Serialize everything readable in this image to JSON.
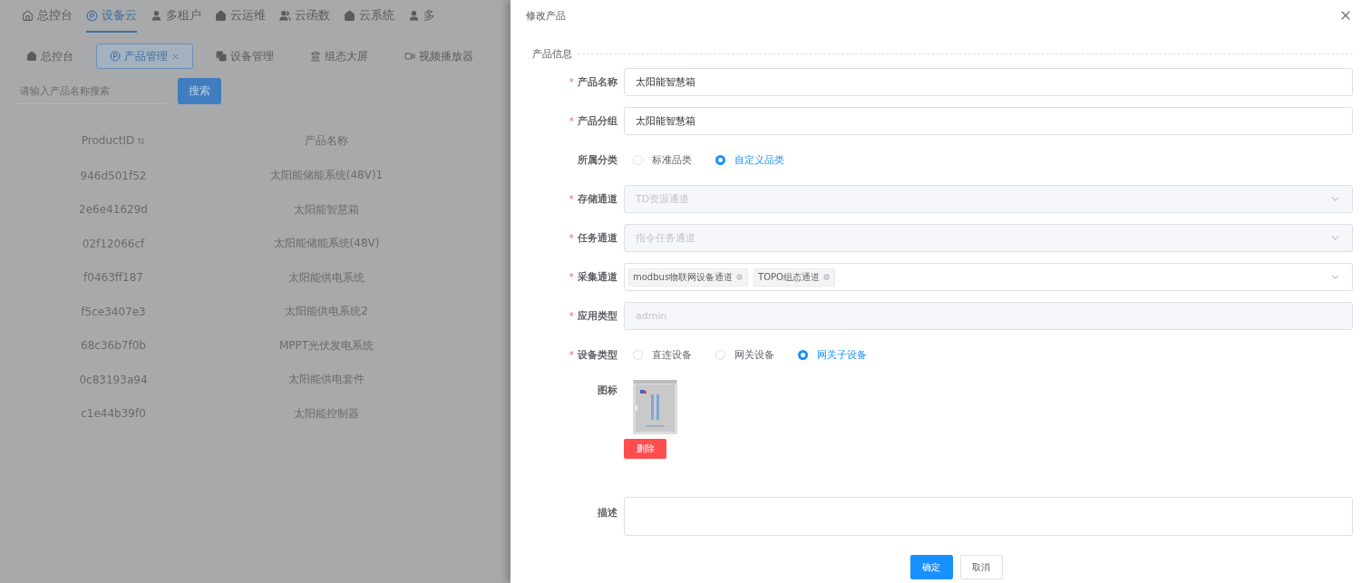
{
  "top_nav": [
    {
      "label": "总控台",
      "selected": false
    },
    {
      "label": "设备云",
      "selected": true
    },
    {
      "label": "多租户",
      "selected": false
    },
    {
      "label": "云运维",
      "selected": false
    },
    {
      "label": "云函数",
      "selected": false
    },
    {
      "label": "云系统",
      "selected": false
    },
    {
      "label": "多",
      "selected": false
    }
  ],
  "tabs": [
    {
      "label": "总控台",
      "selected": false,
      "closable": false
    },
    {
      "label": "产品管理",
      "selected": true,
      "closable": true
    },
    {
      "label": "设备管理",
      "selected": false,
      "closable": false
    },
    {
      "label": "组态大屏",
      "selected": false,
      "closable": false
    },
    {
      "label": "视频播放器",
      "selected": false,
      "closable": false
    }
  ],
  "search": {
    "placeholder": "请输入产品名称搜索",
    "button": "搜索"
  },
  "table": {
    "columns": [
      {
        "label": "ProductID",
        "sortable": true
      },
      {
        "label": "产品名称",
        "sortable": false
      }
    ],
    "rows": [
      [
        "946d501f52",
        "太阳能储能系统(48V)1"
      ],
      [
        "2e6e41629d",
        "太阳能智慧箱"
      ],
      [
        "02f12066cf",
        "太阳能储能系统(48V)"
      ],
      [
        "f0463ff187",
        "太阳能供电系统"
      ],
      [
        "f5ce3407e3",
        "太阳能供电系统2"
      ],
      [
        "68c36b7f0b",
        "MPPT光伏发电系统"
      ],
      [
        "0c83193a94",
        "太阳能供电套件"
      ],
      [
        "c1e44b39f0",
        "太阳能控制器"
      ]
    ]
  },
  "drawer": {
    "title": "修改产品",
    "section": "产品信息",
    "fields": [
      {
        "kind": "input",
        "required_mark": "*",
        "label": "产品名称",
        "value": "太阳能智慧箱",
        "disabled": false
      },
      {
        "kind": "input",
        "required_mark": "*",
        "label": "产品分组",
        "value": "太阳能智慧箱",
        "disabled": false
      },
      {
        "kind": "radio",
        "label": "所属分类",
        "options": [
          {
            "label": "标准品类",
            "selected": false
          },
          {
            "label": "自定义品类",
            "selected": true
          }
        ]
      },
      {
        "kind": "select",
        "required_mark": "*",
        "label": "存储通道",
        "value": "TD资源通道",
        "disabled": true
      },
      {
        "kind": "select",
        "required_mark": "*",
        "label": "任务通道",
        "value": "指令任务通道",
        "disabled": true
      },
      {
        "kind": "tags",
        "required_mark": "*",
        "label": "采集通道",
        "tags": [
          "modbus物联网设备通道",
          "TOPO组态通道"
        ]
      },
      {
        "kind": "input",
        "required_mark": "*",
        "label": "应用类型",
        "value": "admin",
        "disabled": true
      },
      {
        "kind": "radio",
        "required_mark": "*",
        "label": "设备类型",
        "options": [
          {
            "label": "直连设备",
            "selected": false
          },
          {
            "label": "网关设备",
            "selected": false
          },
          {
            "label": "网关子设备",
            "selected": true
          }
        ]
      },
      {
        "label": "图标",
        "button": "删除"
      },
      {
        "kind": "textarea",
        "label": "描述"
      }
    ],
    "buttons": [
      {
        "label": "确定",
        "primary": true
      },
      {
        "label": "取消",
        "primary": false
      }
    ]
  }
}
